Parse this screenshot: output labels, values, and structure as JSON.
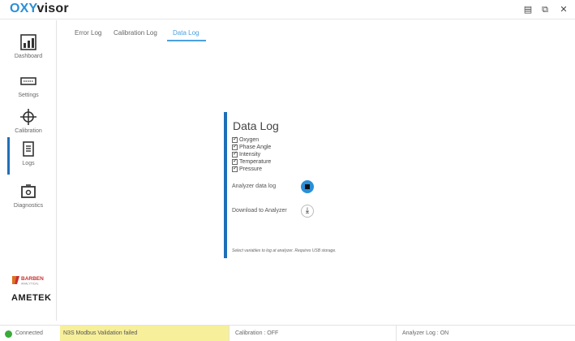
{
  "app": {
    "title_part1": "OXY",
    "title_part2": "visor"
  },
  "window_controls": {
    "minimize": "▤",
    "restore": "⧉",
    "close": "✕"
  },
  "sidebar": {
    "items": [
      {
        "label": "Dashboard",
        "icon": "chart-icon"
      },
      {
        "label": "Settings",
        "icon": "keyboard-icon"
      },
      {
        "label": "Calibration",
        "icon": "crosshair-icon"
      },
      {
        "label": "Logs",
        "icon": "document-icon",
        "active": true
      },
      {
        "label": "Diagnostics",
        "icon": "diagnostics-icon"
      }
    ],
    "logo_barben_line1": "BARBEN",
    "logo_barben_line2": "ANALYTICAL",
    "logo_ametek": "AMETEK"
  },
  "tabs": [
    {
      "label": "Error Log",
      "active": false
    },
    {
      "label": "Calibration Log",
      "active": false
    },
    {
      "label": "Data Log",
      "active": true
    }
  ],
  "panel": {
    "title": "Data Log",
    "variables": [
      {
        "label": "Oxygen",
        "checked": true
      },
      {
        "label": "Phase Angle",
        "checked": true
      },
      {
        "label": "Intensity",
        "checked": true
      },
      {
        "label": "Temperature",
        "checked": true
      },
      {
        "label": "Pressure",
        "checked": true
      }
    ],
    "analyzer_data_log_label": "Analyzer data log",
    "download_label": "Download to Analyzer",
    "hint": "Select variables to log at analyzer. Requires USB storage."
  },
  "status": {
    "connection": "Connected",
    "validation": "N3S Modbus Validation failed",
    "calibration": "Calibration : OFF",
    "analyzer_log": "Analyzer Log : ON"
  },
  "colors": {
    "accent": "#2a8fd8",
    "active_bar": "#1f6fb8",
    "connected": "#3aaa3a",
    "warning_bg": "#f7ef9a"
  }
}
